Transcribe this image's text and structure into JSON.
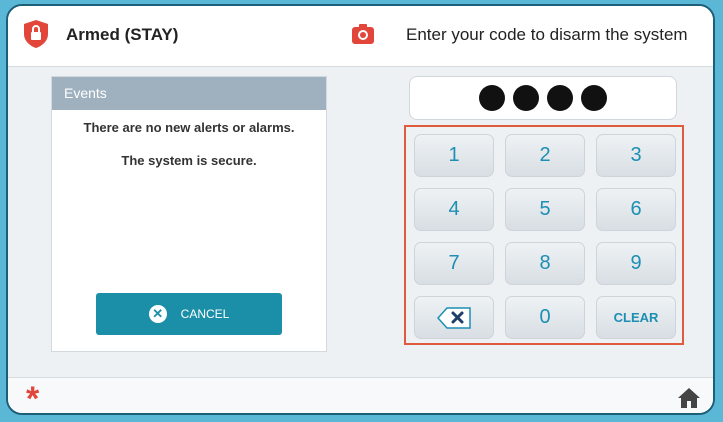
{
  "header": {
    "status_label": "Armed (STAY)",
    "prompt": "Enter your code to disarm the system",
    "status_icon": "lock-shield-icon",
    "camera_icon": "camera-icon"
  },
  "events": {
    "title": "Events",
    "message_1": "There are no new alerts or alarms.",
    "message_2": "The system is secure."
  },
  "cancel_button": {
    "label": "CANCEL",
    "icon": "close-circle-icon"
  },
  "code_entry": {
    "entered_digits": 4
  },
  "keypad": {
    "keys": [
      "1",
      "2",
      "3",
      "4",
      "5",
      "6",
      "7",
      "8",
      "9",
      "0"
    ],
    "backspace_icon": "backspace-icon",
    "clear_label": "CLEAR"
  },
  "footer": {
    "menu_icon": "asterisk-icon",
    "home_icon": "home-icon"
  },
  "colors": {
    "accent": "#1c8fa8",
    "alert": "#e2453a",
    "keypad_outline": "#e05a3e"
  }
}
